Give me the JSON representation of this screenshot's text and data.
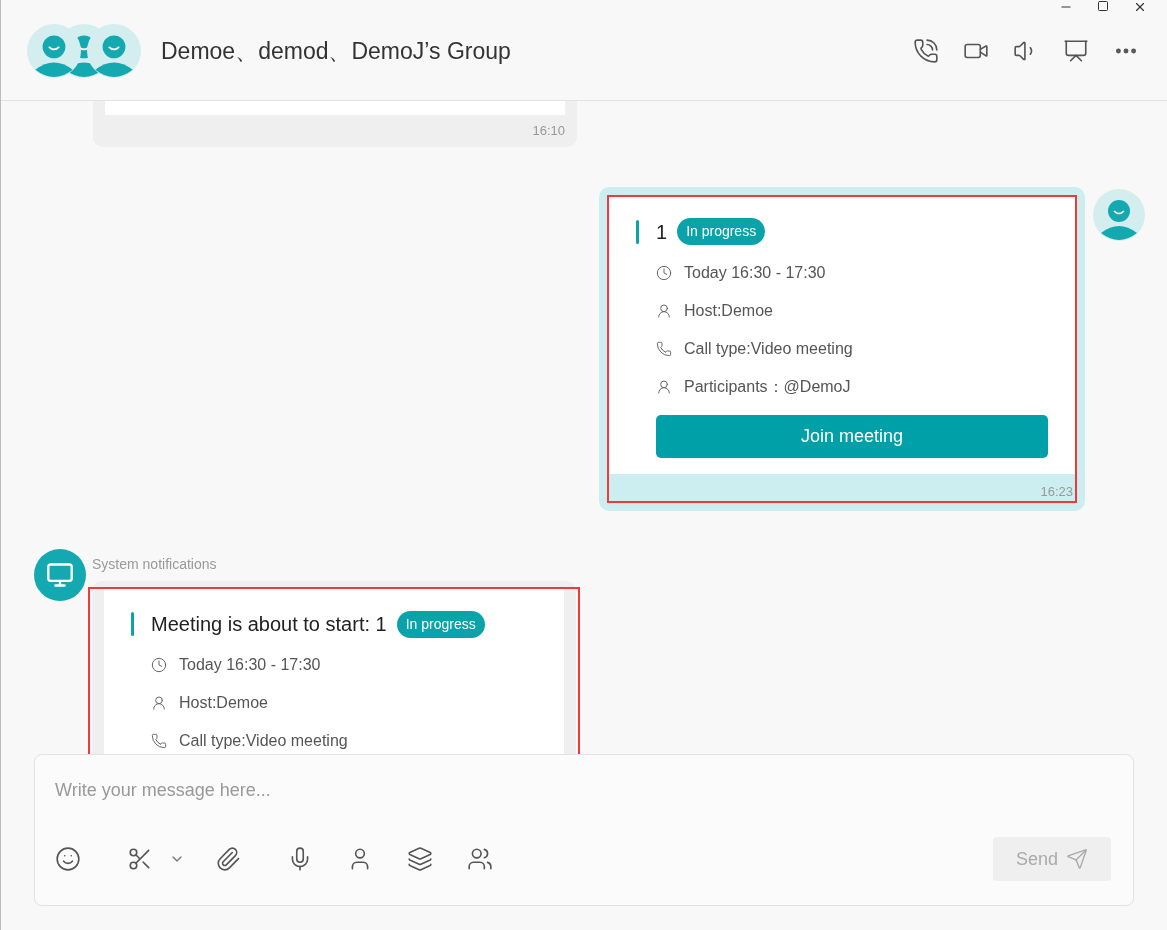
{
  "header": {
    "title": "Demoe、demod、DemoJ’s Group"
  },
  "messages": [
    {
      "kind": "partial",
      "outgoing": false,
      "time": "16:10"
    },
    {
      "kind": "meeting",
      "outgoing": true,
      "highlighted": true,
      "title": "1",
      "status": "In progress",
      "details": [
        {
          "kind": "time",
          "text": "Today 16:30 - 17:30"
        },
        {
          "kind": "host",
          "text": "Host:Demoe"
        },
        {
          "kind": "call",
          "text": "Call type:Video meeting"
        },
        {
          "kind": "participants",
          "text": "Participants：@DemoJ"
        }
      ],
      "button": "Join meeting",
      "time": "16:23"
    },
    {
      "kind": "meeting",
      "outgoing": false,
      "sender": "System notifications",
      "highlighted": true,
      "title": "Meeting is about to start: 1",
      "status": "In progress",
      "details": [
        {
          "kind": "time",
          "text": "Today 16:30 - 17:30"
        },
        {
          "kind": "host",
          "text": "Host:Demoe"
        },
        {
          "kind": "call",
          "text": "Call type:Video meeting"
        }
      ]
    }
  ],
  "composer": {
    "placeholder": "Write your message here...",
    "send": "Send"
  }
}
